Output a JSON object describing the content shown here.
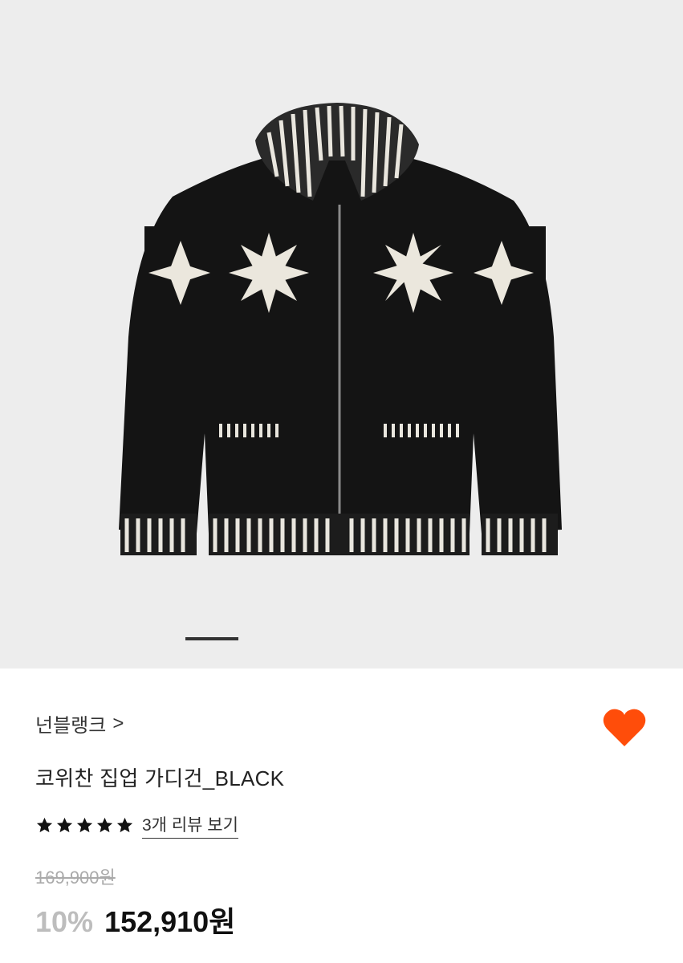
{
  "gallery": {
    "image_alt": "코위찬 집업 가디건 product photo",
    "slide_progress": 0.25
  },
  "product": {
    "brand": "넌블랭크",
    "brand_chevron": ">",
    "name": "코위찬 집업 가디건_BLACK",
    "rating_stars": 5,
    "review_link": "3개 리뷰 보기",
    "original_price": "169,900원",
    "discount": "10%",
    "sale_price": "152,910원"
  },
  "icons": {
    "wishlist": "heart-icon",
    "brand_nav": "chevron-right-icon",
    "rating": "star-icon"
  },
  "colors": {
    "heart": "#ff4d0a",
    "discount": "#bdbdbd",
    "original_price": "#aaaaaa",
    "gallery_bg": "#ededed"
  }
}
